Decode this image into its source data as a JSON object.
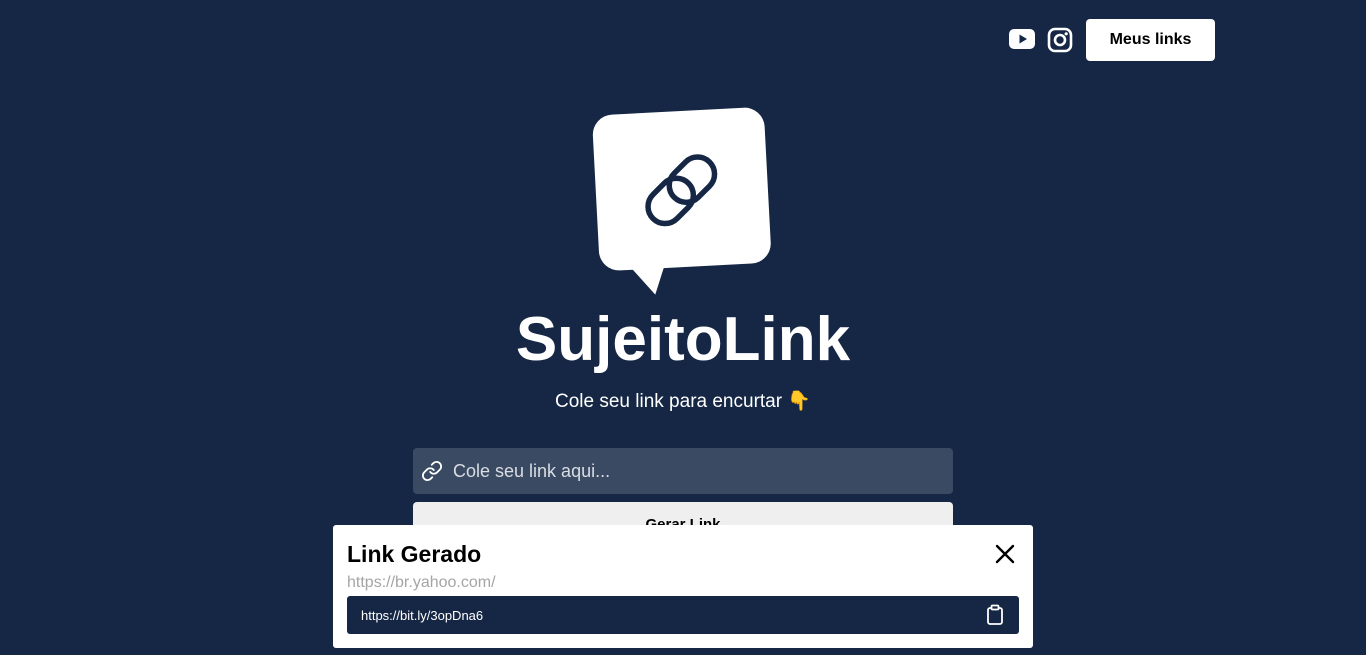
{
  "header": {
    "youtube_icon": "youtube-icon",
    "instagram_icon": "instagram-icon",
    "my_links_label": "Meus links"
  },
  "hero": {
    "logo_icon": "chain-link-speech-bubble-icon",
    "title": "SujeitoLink",
    "tagline": "Cole seu link para encurtar 👇"
  },
  "form": {
    "input_icon": "link-icon",
    "input_placeholder": "Cole seu link aqui...",
    "input_value": "",
    "generate_label": "Gerar Link"
  },
  "modal": {
    "title": "Link Gerado",
    "close_icon": "close-icon",
    "original_url": "https://br.yahoo.com/",
    "short_url": "https://bit.ly/3opDna6",
    "copy_icon": "clipboard-icon"
  },
  "colors": {
    "background": "#152744",
    "input_background": "#3b4a63",
    "button_background": "#ffffff",
    "generate_button_background": "#efefef",
    "muted_text": "#a5a5a5"
  }
}
